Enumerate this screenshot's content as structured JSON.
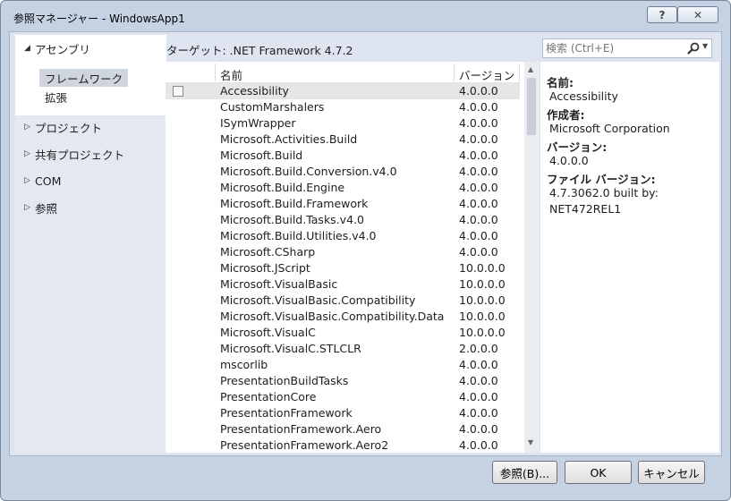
{
  "window": {
    "title": "参照マネージャー - WindowsApp1",
    "help_label": "?",
    "close_label": "✕"
  },
  "nav": {
    "groups": [
      {
        "label": "アセンブリ",
        "expanded": true
      },
      {
        "label": "プロジェクト",
        "expanded": false
      },
      {
        "label": "共有プロジェクト",
        "expanded": false
      },
      {
        "label": "COM",
        "expanded": false
      },
      {
        "label": "参照",
        "expanded": false
      }
    ],
    "subitems": [
      {
        "label": "フレームワーク",
        "selected": true
      },
      {
        "label": "拡張",
        "selected": false
      }
    ]
  },
  "target": "ターゲット: .NET Framework 4.7.2",
  "search": {
    "placeholder": "検索 (Ctrl+E)"
  },
  "grid": {
    "columns": {
      "name": "名前",
      "version": "バージョン"
    },
    "rows": [
      {
        "name": "Accessibility",
        "version": "4.0.0.0",
        "selected": true,
        "checked": false
      },
      {
        "name": "CustomMarshalers",
        "version": "4.0.0.0"
      },
      {
        "name": "ISymWrapper",
        "version": "4.0.0.0"
      },
      {
        "name": "Microsoft.Activities.Build",
        "version": "4.0.0.0"
      },
      {
        "name": "Microsoft.Build",
        "version": "4.0.0.0"
      },
      {
        "name": "Microsoft.Build.Conversion.v4.0",
        "version": "4.0.0.0"
      },
      {
        "name": "Microsoft.Build.Engine",
        "version": "4.0.0.0"
      },
      {
        "name": "Microsoft.Build.Framework",
        "version": "4.0.0.0"
      },
      {
        "name": "Microsoft.Build.Tasks.v4.0",
        "version": "4.0.0.0"
      },
      {
        "name": "Microsoft.Build.Utilities.v4.0",
        "version": "4.0.0.0"
      },
      {
        "name": "Microsoft.CSharp",
        "version": "4.0.0.0"
      },
      {
        "name": "Microsoft.JScript",
        "version": "10.0.0.0"
      },
      {
        "name": "Microsoft.VisualBasic",
        "version": "10.0.0.0"
      },
      {
        "name": "Microsoft.VisualBasic.Compatibility",
        "version": "10.0.0.0"
      },
      {
        "name": "Microsoft.VisualBasic.Compatibility.Data",
        "version": "10.0.0.0"
      },
      {
        "name": "Microsoft.VisualC",
        "version": "10.0.0.0"
      },
      {
        "name": "Microsoft.VisualC.STLCLR",
        "version": "2.0.0.0"
      },
      {
        "name": "mscorlib",
        "version": "4.0.0.0"
      },
      {
        "name": "PresentationBuildTasks",
        "version": "4.0.0.0"
      },
      {
        "name": "PresentationCore",
        "version": "4.0.0.0"
      },
      {
        "name": "PresentationFramework",
        "version": "4.0.0.0"
      },
      {
        "name": "PresentationFramework.Aero",
        "version": "4.0.0.0"
      },
      {
        "name": "PresentationFramework.Aero2",
        "version": "4.0.0.0"
      }
    ]
  },
  "details": {
    "name_label": "名前:",
    "name_value": "Accessibility",
    "author_label": "作成者:",
    "author_value": "Microsoft Corporation",
    "version_label": "バージョン:",
    "version_value": "4.0.0.0",
    "file_version_label": "ファイル バージョン:",
    "file_version_line1": "4.7.3062.0 built by:",
    "file_version_line2": "NET472REL1"
  },
  "buttons": {
    "browse": "参照(B)...",
    "ok": "OK",
    "cancel": "キャンセル"
  }
}
